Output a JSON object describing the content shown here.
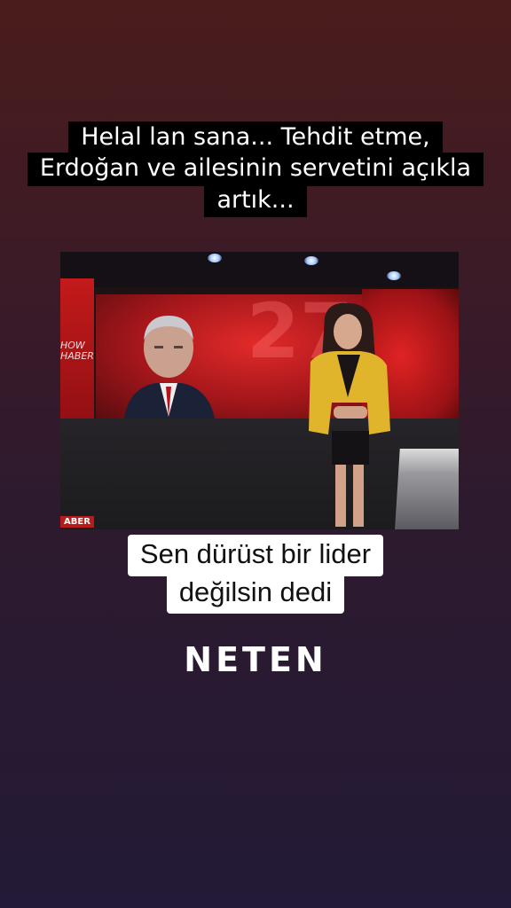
{
  "overlay_caption": {
    "lines": [
      "Helal lan sana... Tehdit etme,",
      "Erdoğan ve ailesinin servetini açıkla",
      "artık..."
    ]
  },
  "video": {
    "wall_brand": "HOW\nHABER",
    "lower_tag": "ABER",
    "background_number": "27"
  },
  "subtitle": {
    "lines": [
      "Sen dürüst bir lider",
      "değilsin dedi"
    ]
  },
  "watermark": {
    "text": "NETEN"
  }
}
